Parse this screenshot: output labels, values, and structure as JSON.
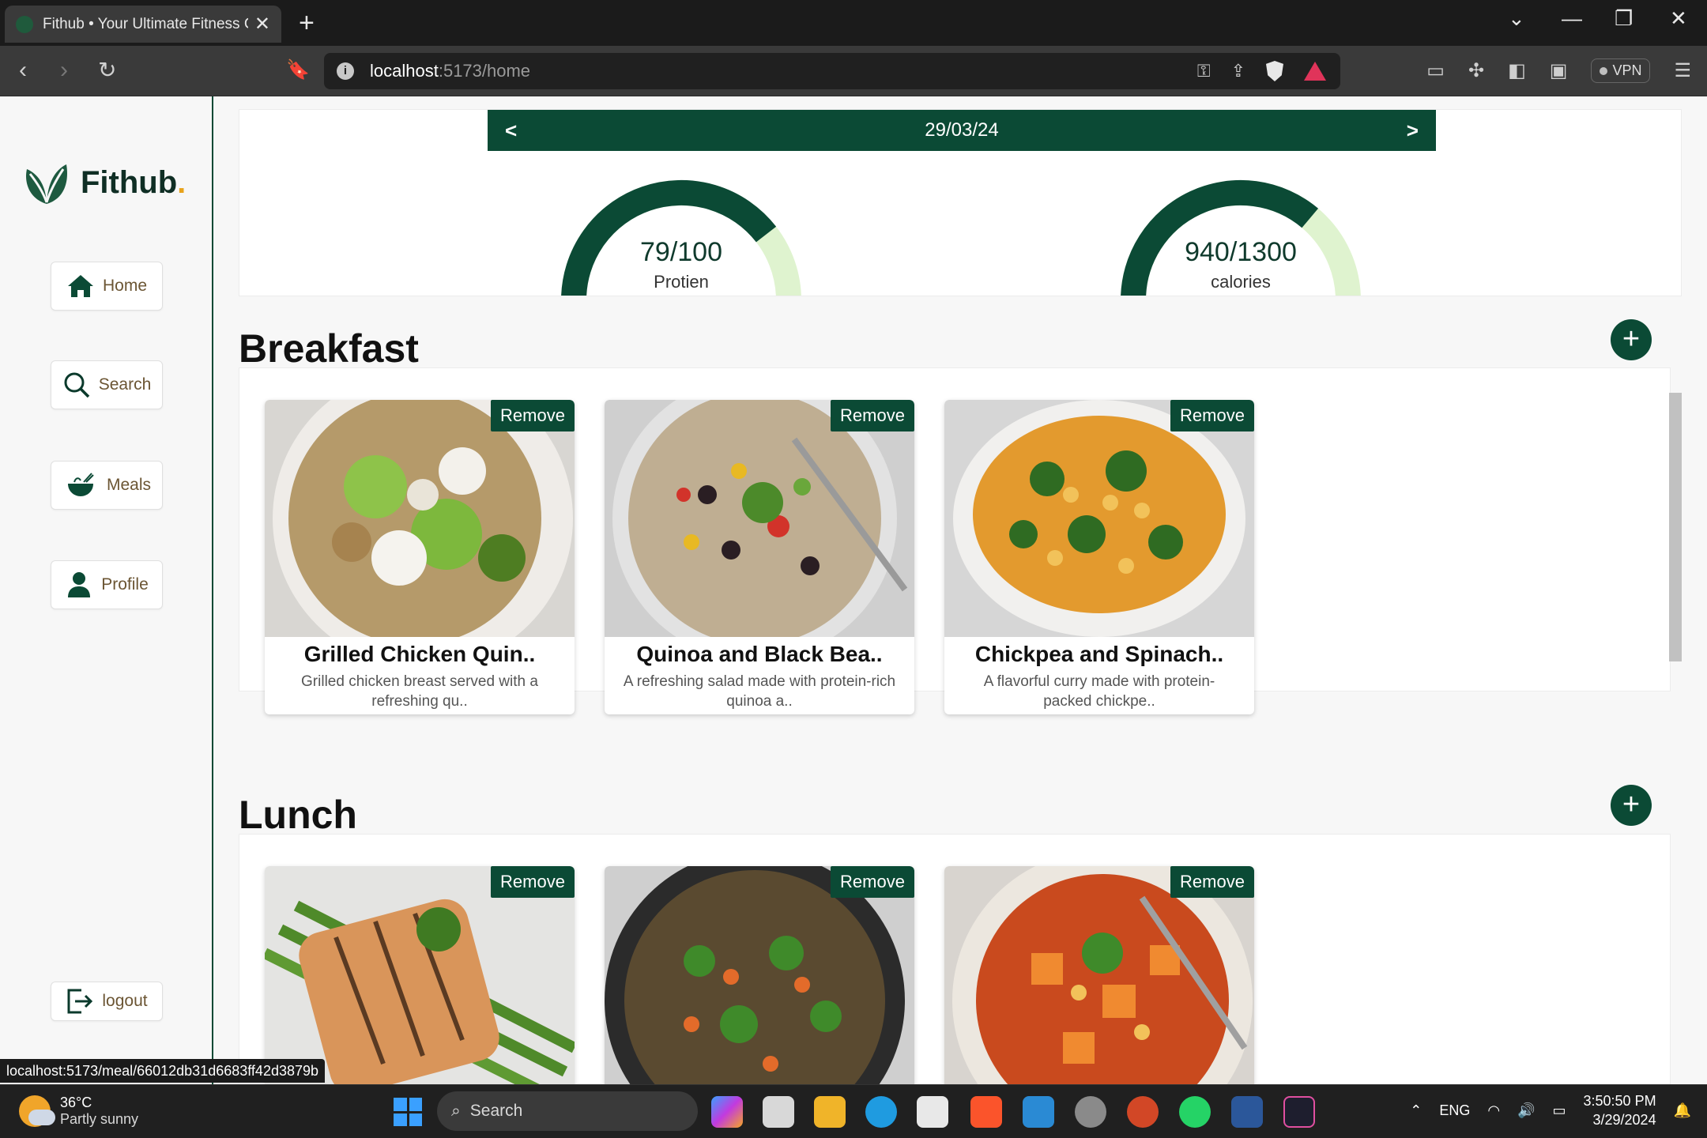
{
  "browser": {
    "tab_title": "Fithub • Your Ultimate Fitness Companion",
    "tab_close": "✕",
    "new_tab": "+",
    "url_host": "localhost",
    "url_path": ":5173/home",
    "vpn_label": "VPN",
    "status_url": "localhost:5173/meal/66012db31d6683ff42d3879b"
  },
  "sidebar": {
    "brand": "Fithub",
    "brand_dot": ".",
    "items": [
      {
        "label": "Home",
        "icon": "home-icon"
      },
      {
        "label": "Search",
        "icon": "search-icon"
      },
      {
        "label": "Meals",
        "icon": "bowl-icon"
      },
      {
        "label": "Profile",
        "icon": "user-icon"
      }
    ],
    "logout": "logout"
  },
  "summary": {
    "date": "29/03/24",
    "prev": "<",
    "next": ">",
    "protein": {
      "value": "79/100",
      "label": "Protien",
      "progress": 0.79
    },
    "calories": {
      "value": "940/1300",
      "label": "calories",
      "progress": 0.723
    }
  },
  "breakfast": {
    "title": "Breakfast",
    "add": "+",
    "remove_label": "Remove",
    "meals": [
      {
        "title": "Grilled Chicken Quin..",
        "desc": "Grilled chicken breast served with a refreshing qu.."
      },
      {
        "title": "Quinoa and Black Bea..",
        "desc": "A refreshing salad made with protein-rich quinoa a.."
      },
      {
        "title": "Chickpea and Spinach..",
        "desc": "A flavorful curry made with protein-packed chickpe.."
      }
    ]
  },
  "lunch": {
    "title": "Lunch",
    "add": "+",
    "remove_label": "Remove"
  },
  "taskbar": {
    "weather_temp": "36°C",
    "weather_desc": "Partly sunny",
    "search": "Search",
    "lang": "ENG",
    "time": "3:50:50 PM",
    "date": "3/29/2024"
  },
  "colors": {
    "primary": "#0b4a35",
    "gauge_track": "#dff3cf",
    "accent_dot": "#e8a31c"
  }
}
